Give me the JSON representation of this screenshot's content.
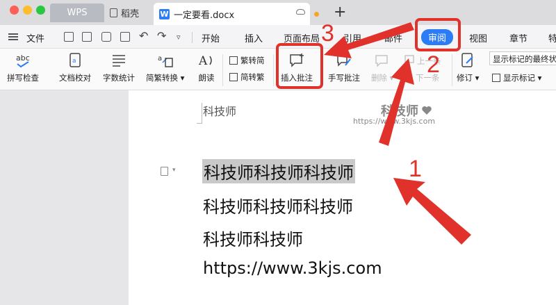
{
  "window": {
    "tabs": [
      {
        "label": "WPS"
      },
      {
        "label": "稻壳"
      },
      {
        "label": "一定要看.docx"
      }
    ]
  },
  "menubar": {
    "file_label": "文件",
    "tabs": [
      {
        "label": "开始"
      },
      {
        "label": "插入"
      },
      {
        "label": "页面布局"
      },
      {
        "label": "引用"
      },
      {
        "label": "邮件"
      },
      {
        "label": "审阅",
        "active": true
      },
      {
        "label": "视图"
      },
      {
        "label": "章节"
      },
      {
        "label": "特"
      }
    ]
  },
  "ribbon": {
    "spell_check": "拼写检查",
    "doc_proof": "文档校对",
    "word_count": "字数统计",
    "trad_simp": "简繁转换",
    "read_aloud": "朗读",
    "to_simplified": "繁转简",
    "to_traditional": "简转繁",
    "insert_comment": "插入批注",
    "handwrite_comment": "手写批注",
    "delete": "删除",
    "prev": "上一条",
    "next": "下一条",
    "revise": "修订",
    "show_markup": "显示标记",
    "markup_select": "显示标记的最终状态"
  },
  "document": {
    "header": "科技师",
    "watermark_title": "科技师",
    "watermark_url": "https://www.3kjs.com",
    "lines": [
      "科技师科技师科技师",
      "科技师科技师科技师",
      "科技师科技师",
      "https://www.3kjs.com"
    ]
  },
  "annotations": {
    "step1": "1",
    "step2": "2",
    "step3": "3"
  },
  "colors": {
    "accent": "#2b7cf5",
    "annotation": "#e0322b",
    "selection": "#c9c9c9"
  }
}
